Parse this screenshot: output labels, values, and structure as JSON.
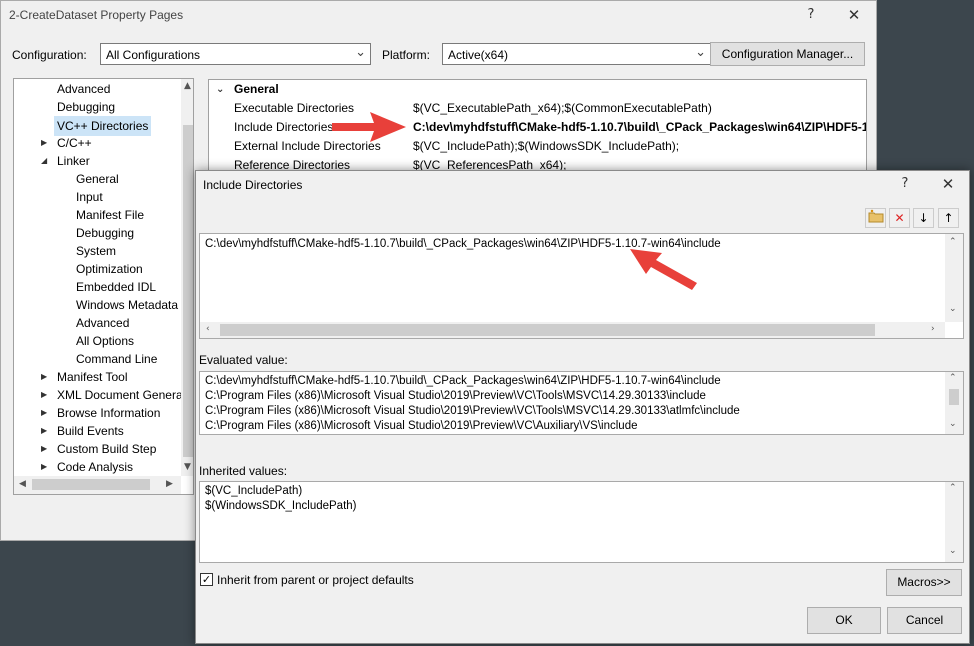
{
  "property_pages": {
    "title": "2-CreateDataset Property Pages",
    "help_button": "?",
    "close_button": "✕",
    "configuration_label": "Configuration:",
    "configuration_value": "All Configurations",
    "platform_label": "Platform:",
    "platform_value": "Active(x64)",
    "configuration_manager_button": "Configuration Manager...",
    "tree": {
      "items": [
        {
          "label": "Advanced"
        },
        {
          "label": "Debugging"
        },
        {
          "label": "VC++ Directories",
          "selected": true
        },
        {
          "label": "C/C++"
        },
        {
          "label": "Linker"
        },
        {
          "label": "General"
        },
        {
          "label": "Input"
        },
        {
          "label": "Manifest File"
        },
        {
          "label": "Debugging"
        },
        {
          "label": "System"
        },
        {
          "label": "Optimization"
        },
        {
          "label": "Embedded IDL"
        },
        {
          "label": "Windows Metadata"
        },
        {
          "label": "Advanced"
        },
        {
          "label": "All Options"
        },
        {
          "label": "Command Line"
        },
        {
          "label": "Manifest Tool"
        },
        {
          "label": "XML Document Genera"
        },
        {
          "label": "Browse Information"
        },
        {
          "label": "Build Events"
        },
        {
          "label": "Custom Build Step"
        },
        {
          "label": "Code Analysis"
        }
      ]
    },
    "grid": {
      "section_title": "General",
      "rows": [
        {
          "name": "Executable Directories",
          "value": "$(VC_ExecutablePath_x64);$(CommonExecutablePath)"
        },
        {
          "name": "Include Directories",
          "value": "C:\\dev\\myhdfstuff\\CMake-hdf5-1.10.7\\build\\_CPack_Packages\\win64\\ZIP\\HDF5-1"
        },
        {
          "name": "External Include Directories",
          "value": "$(VC_IncludePath);$(WindowsSDK_IncludePath);"
        },
        {
          "name": "Reference Directories",
          "value": "$(VC_ReferencesPath_x64);"
        }
      ]
    }
  },
  "include_dialog": {
    "title": "Include Directories",
    "help_button": "?",
    "close_button": "✕",
    "toolbar": {
      "new_line_icon": "new-folder-icon",
      "delete_icon": "delete-icon",
      "move_down_icon": "arrow-down-icon",
      "move_up_icon": "arrow-up-icon"
    },
    "edit_value": "C:\\dev\\myhdfstuff\\CMake-hdf5-1.10.7\\build\\_CPack_Packages\\win64\\ZIP\\HDF5-1.10.7-win64\\include",
    "evaluated_label": "Evaluated value:",
    "evaluated_lines": [
      "C:\\dev\\myhdfstuff\\CMake-hdf5-1.10.7\\build\\_CPack_Packages\\win64\\ZIP\\HDF5-1.10.7-win64\\include",
      "C:\\Program Files (x86)\\Microsoft Visual Studio\\2019\\Preview\\VC\\Tools\\MSVC\\14.29.30133\\include",
      "C:\\Program Files (x86)\\Microsoft Visual Studio\\2019\\Preview\\VC\\Tools\\MSVC\\14.29.30133\\atlmfc\\include",
      "C:\\Program Files (x86)\\Microsoft Visual Studio\\2019\\Preview\\VC\\Auxiliary\\VS\\include"
    ],
    "inherited_label": "Inherited values:",
    "inherited_lines": [
      "$(VC_IncludePath)",
      "$(WindowsSDK_IncludePath)"
    ],
    "inherit_checkbox_label": "Inherit from parent or project defaults",
    "inherit_checked": true,
    "macros_button": "Macros>>",
    "ok_button": "OK",
    "cancel_button": "Cancel"
  },
  "colors": {
    "annotation_arrow": "#e8403a",
    "selection": "#cce4f7",
    "desktop": "#3c464d"
  }
}
